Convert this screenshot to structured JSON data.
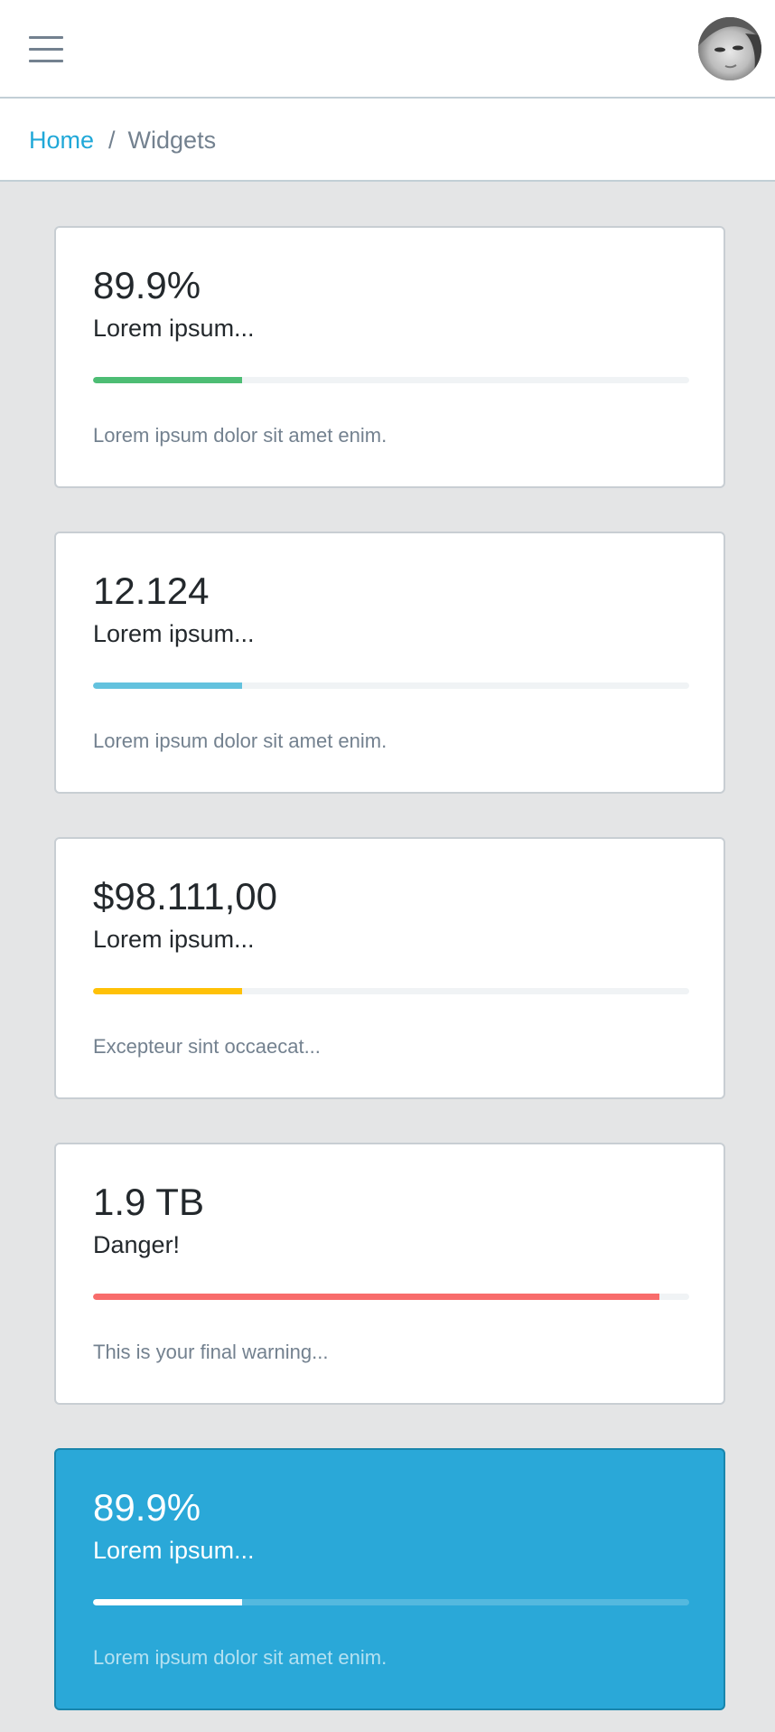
{
  "header": {
    "menu_icon": "hamburger-menu-icon",
    "avatar_icon": "user-avatar"
  },
  "breadcrumb": {
    "home": "Home",
    "separator": "/",
    "current": "Widgets"
  },
  "cards": [
    {
      "value": "89.9%",
      "label": "Lorem ipsum...",
      "progress": 0.25,
      "color": "#4dbd74",
      "note": "Lorem ipsum dolor sit amet enim.",
      "variant": "white"
    },
    {
      "value": "12.124",
      "label": "Lorem ipsum...",
      "progress": 0.25,
      "color": "#63c2de",
      "note": "Lorem ipsum dolor sit amet enim.",
      "variant": "white"
    },
    {
      "value": "$98.111,00",
      "label": "Lorem ipsum...",
      "progress": 0.25,
      "color": "#ffc107",
      "note": "Excepteur sint occaecat...",
      "variant": "white"
    },
    {
      "value": "1.9 TB",
      "label": "Danger!",
      "progress": 0.95,
      "color": "#f86c6b",
      "note": "This is your final warning...",
      "variant": "white"
    },
    {
      "value": "89.9%",
      "label": "Lorem ipsum...",
      "progress": 0.25,
      "color": "#ffffff",
      "note": "Lorem ipsum dolor sit amet enim.",
      "variant": "primary",
      "background": "#2aa8d8"
    }
  ]
}
